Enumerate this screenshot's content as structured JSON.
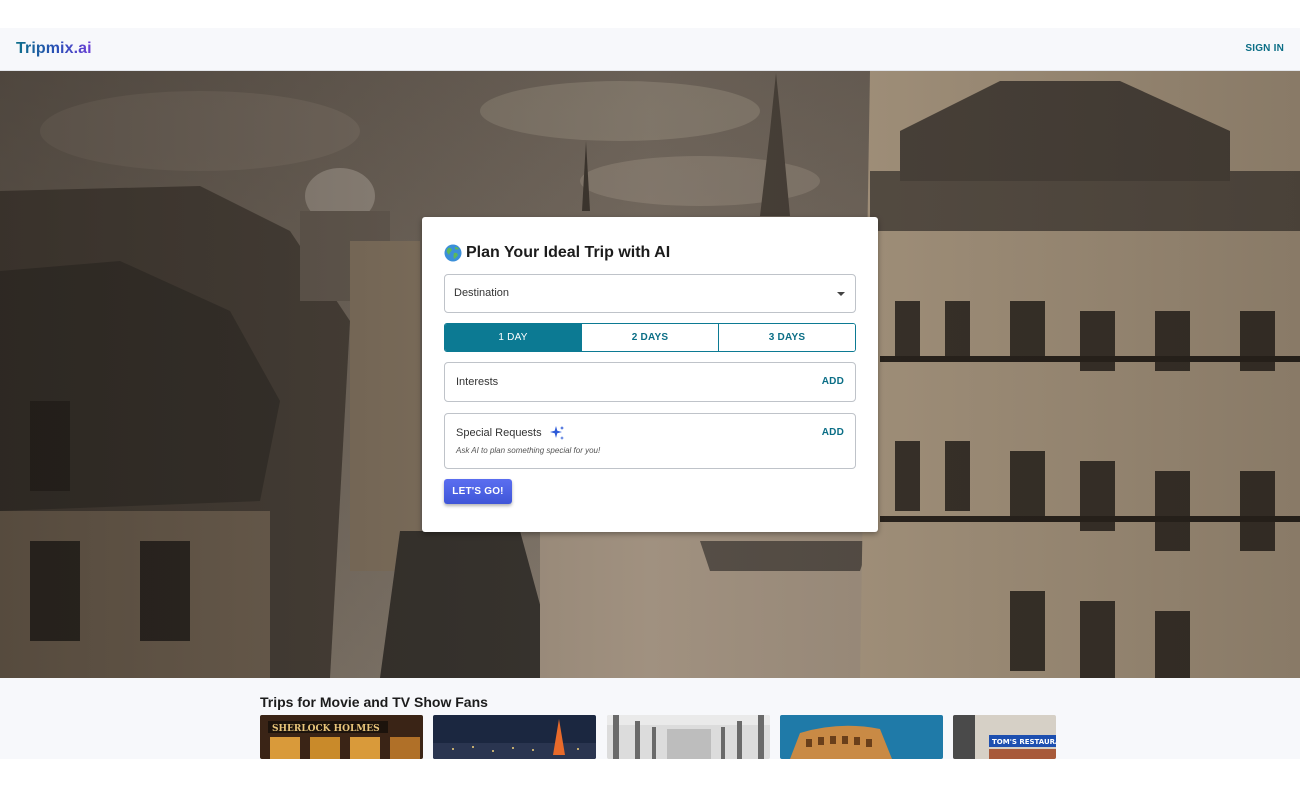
{
  "navbar": {
    "logo": "Tripmix.ai",
    "sign_in": "SIGN IN"
  },
  "planner": {
    "title": "Plan Your Ideal Trip with AI",
    "title_icon": "globe-emoji",
    "destination_placeholder": "Destination",
    "day_options": [
      {
        "label": "1 DAY",
        "selected": true
      },
      {
        "label": "2 DAYS",
        "selected": false
      },
      {
        "label": "3 DAYS",
        "selected": false
      }
    ],
    "interests_label": "Interests",
    "interests_add": "ADD",
    "special_label": "Special Requests",
    "special_icon": "sparkle-icon",
    "special_hint": "Ask AI to plan something special for you!",
    "special_add": "ADD",
    "submit": "LET'S GO!"
  },
  "section": {
    "title": "Trips for Movie and TV Show Fans",
    "thumbnails": [
      {
        "alt": "Sherlock Holmes pub",
        "sign_text": "SHERLOCK HOLMES"
      },
      {
        "alt": "Tokyo Tower at night"
      },
      {
        "alt": "Bridge colonnade"
      },
      {
        "alt": "Colosseum"
      },
      {
        "alt": "New York diner",
        "sign_text": "TOM'S RESTAURANT"
      }
    ]
  },
  "colors": {
    "accent": "#0c7a93",
    "button": "#4a5fe0",
    "nav_background": "#f7f8fb"
  }
}
